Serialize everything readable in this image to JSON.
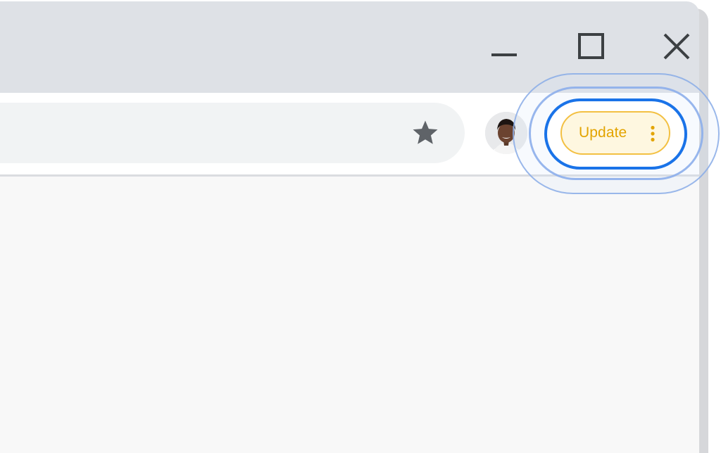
{
  "window_controls": {
    "minimize_icon": "minimize-icon",
    "maximize_icon": "maximize-icon",
    "close_icon": "close-icon"
  },
  "omnibox": {
    "star_icon": "star-icon"
  },
  "profile": {
    "avatar_icon": "profile-avatar"
  },
  "update_button": {
    "label": "Update",
    "menu_icon": "more-vert-icon",
    "text_color": "#e3a400",
    "background": "#fef7e0",
    "border": "#f3c042"
  },
  "colors": {
    "titlebar": "#dee1e6",
    "toolbar": "#ffffff",
    "content": "#f8f8f8",
    "highlight_ring": "#1a73e8",
    "icon": "#3c4043"
  }
}
